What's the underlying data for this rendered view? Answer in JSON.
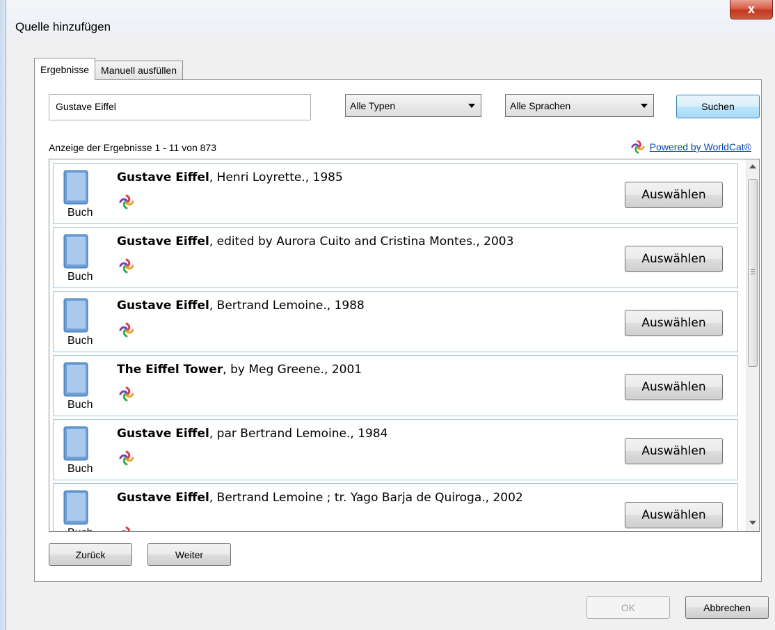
{
  "window": {
    "title": "Quelle hinzufügen",
    "close_label": "x"
  },
  "tabs": [
    {
      "label": "Ergebnisse",
      "active": true
    },
    {
      "label": "Manuell ausfüllen",
      "active": false
    }
  ],
  "search": {
    "query": "Gustave Eiffel",
    "type_select": "Alle Typen",
    "language_select": "Alle Sprachen",
    "search_button": "Suchen"
  },
  "results": {
    "summary": "Anzeige der Ergebnisse 1 - 11 von 873",
    "powered_by": "Powered by WorldCat®",
    "items": [
      {
        "type": "Buch",
        "title": "Gustave Eiffel",
        "rest": ", Henri Loyrette., 1985",
        "button": "Auswählen"
      },
      {
        "type": "Buch",
        "title": "Gustave Eiffel",
        "rest": ", edited by Aurora Cuito and Cristina Montes., 2003",
        "button": "Auswählen"
      },
      {
        "type": "Buch",
        "title": "Gustave Eiffel",
        "rest": ", Bertrand Lemoine., 1988",
        "button": "Auswählen"
      },
      {
        "type": "Buch",
        "title": "The Eiffel Tower",
        "rest": ", by Meg Greene., 2001",
        "button": "Auswählen"
      },
      {
        "type": "Buch",
        "title": "Gustave Eiffel",
        "rest": ", par Bertrand Lemoine., 1984",
        "button": "Auswählen"
      },
      {
        "type": "Buch",
        "title": "Gustave Eiffel",
        "rest": ", Bertrand Lemoine ; tr. Yago Barja de Quiroga., 2002",
        "button": "Auswählen"
      }
    ]
  },
  "pagination": {
    "back": "Zurück",
    "next": "Weiter"
  },
  "footer": {
    "ok": "OK",
    "cancel": "Abbrechen"
  },
  "colors": {
    "item_border": "#9ec5e4",
    "book_icon": "#6d9fd6",
    "link": "#0645ad"
  },
  "icons": {
    "book": "book-icon",
    "worldcat": "worldcat-logo-icon",
    "close": "close-icon",
    "dropdown": "chevron-down-icon"
  }
}
